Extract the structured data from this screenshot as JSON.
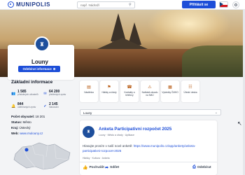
{
  "header": {
    "logo_text": "MUNIPOLIS",
    "search_placeholder": "např. Nádraží",
    "login_label": "Přihlásit se",
    "language_icon": "czech-flag-icon",
    "settings_icon": "gear-icon"
  },
  "profile": {
    "city_name": "Louny",
    "info_button_label": "Odebírat informace",
    "info_heading": "Základní informace",
    "stats": [
      {
        "value": "1 585",
        "label": "příslušných uživatelů",
        "icon": "users-icon",
        "color": "#1d4ed8"
      },
      {
        "value": "64 200",
        "label": "přečtených zpráv",
        "icon": "mail-icon",
        "color": "#1d4ed8"
      },
      {
        "value": "844",
        "label": "odebíraných zpráv",
        "icon": "bell-icon",
        "color": "#1d4ed8"
      },
      {
        "value": "2 145",
        "label": "hlasování",
        "icon": "check-icon",
        "color": "#1d4ed8"
      }
    ],
    "details": {
      "population_label": "Počet obyvatel:",
      "population_value": "18 201",
      "status_label": "Status:",
      "status_value": "Město",
      "region_label": "Kraj:",
      "region_value": "Ústecký",
      "web_label": "Web:",
      "web_value": "www.mulouny.cz"
    }
  },
  "quick_links": [
    {
      "label": "Nástěnka",
      "icon": "board-icon",
      "color": "#b45309"
    },
    {
      "label": "Hlášky a úřady",
      "icon": "flag-icon",
      "color": "#b45309"
    },
    {
      "label": "Kontakty a telefony",
      "icon": "phone-icon",
      "color": "#b45309"
    },
    {
      "label": "Nahlásit závadu na MěÚ",
      "icon": "warning-icon",
      "color": "#b45309"
    },
    {
      "label": "Výsledky ČMHO",
      "icon": "chart-icon",
      "color": "#b45309"
    },
    {
      "label": "Úřední deska",
      "icon": "document-icon",
      "color": "#b45309"
    }
  ],
  "filter": {
    "value": "Louny"
  },
  "post": {
    "title": "Anketa Participativní rozpočet 2025",
    "meta": "Louny · Město a úřady · Aplikace",
    "body_text": "Hlasujte prosím v naší nové anketě: ",
    "body_link": "https://www.munipolis.cz/app/ankety/anketa-participativni-rozpocet-2025",
    "categories": "Hlášky · Kultura · Anketa",
    "like_label": "Pochválit",
    "share_label": "Sdílet",
    "subscribe_label": "Odebírat"
  }
}
